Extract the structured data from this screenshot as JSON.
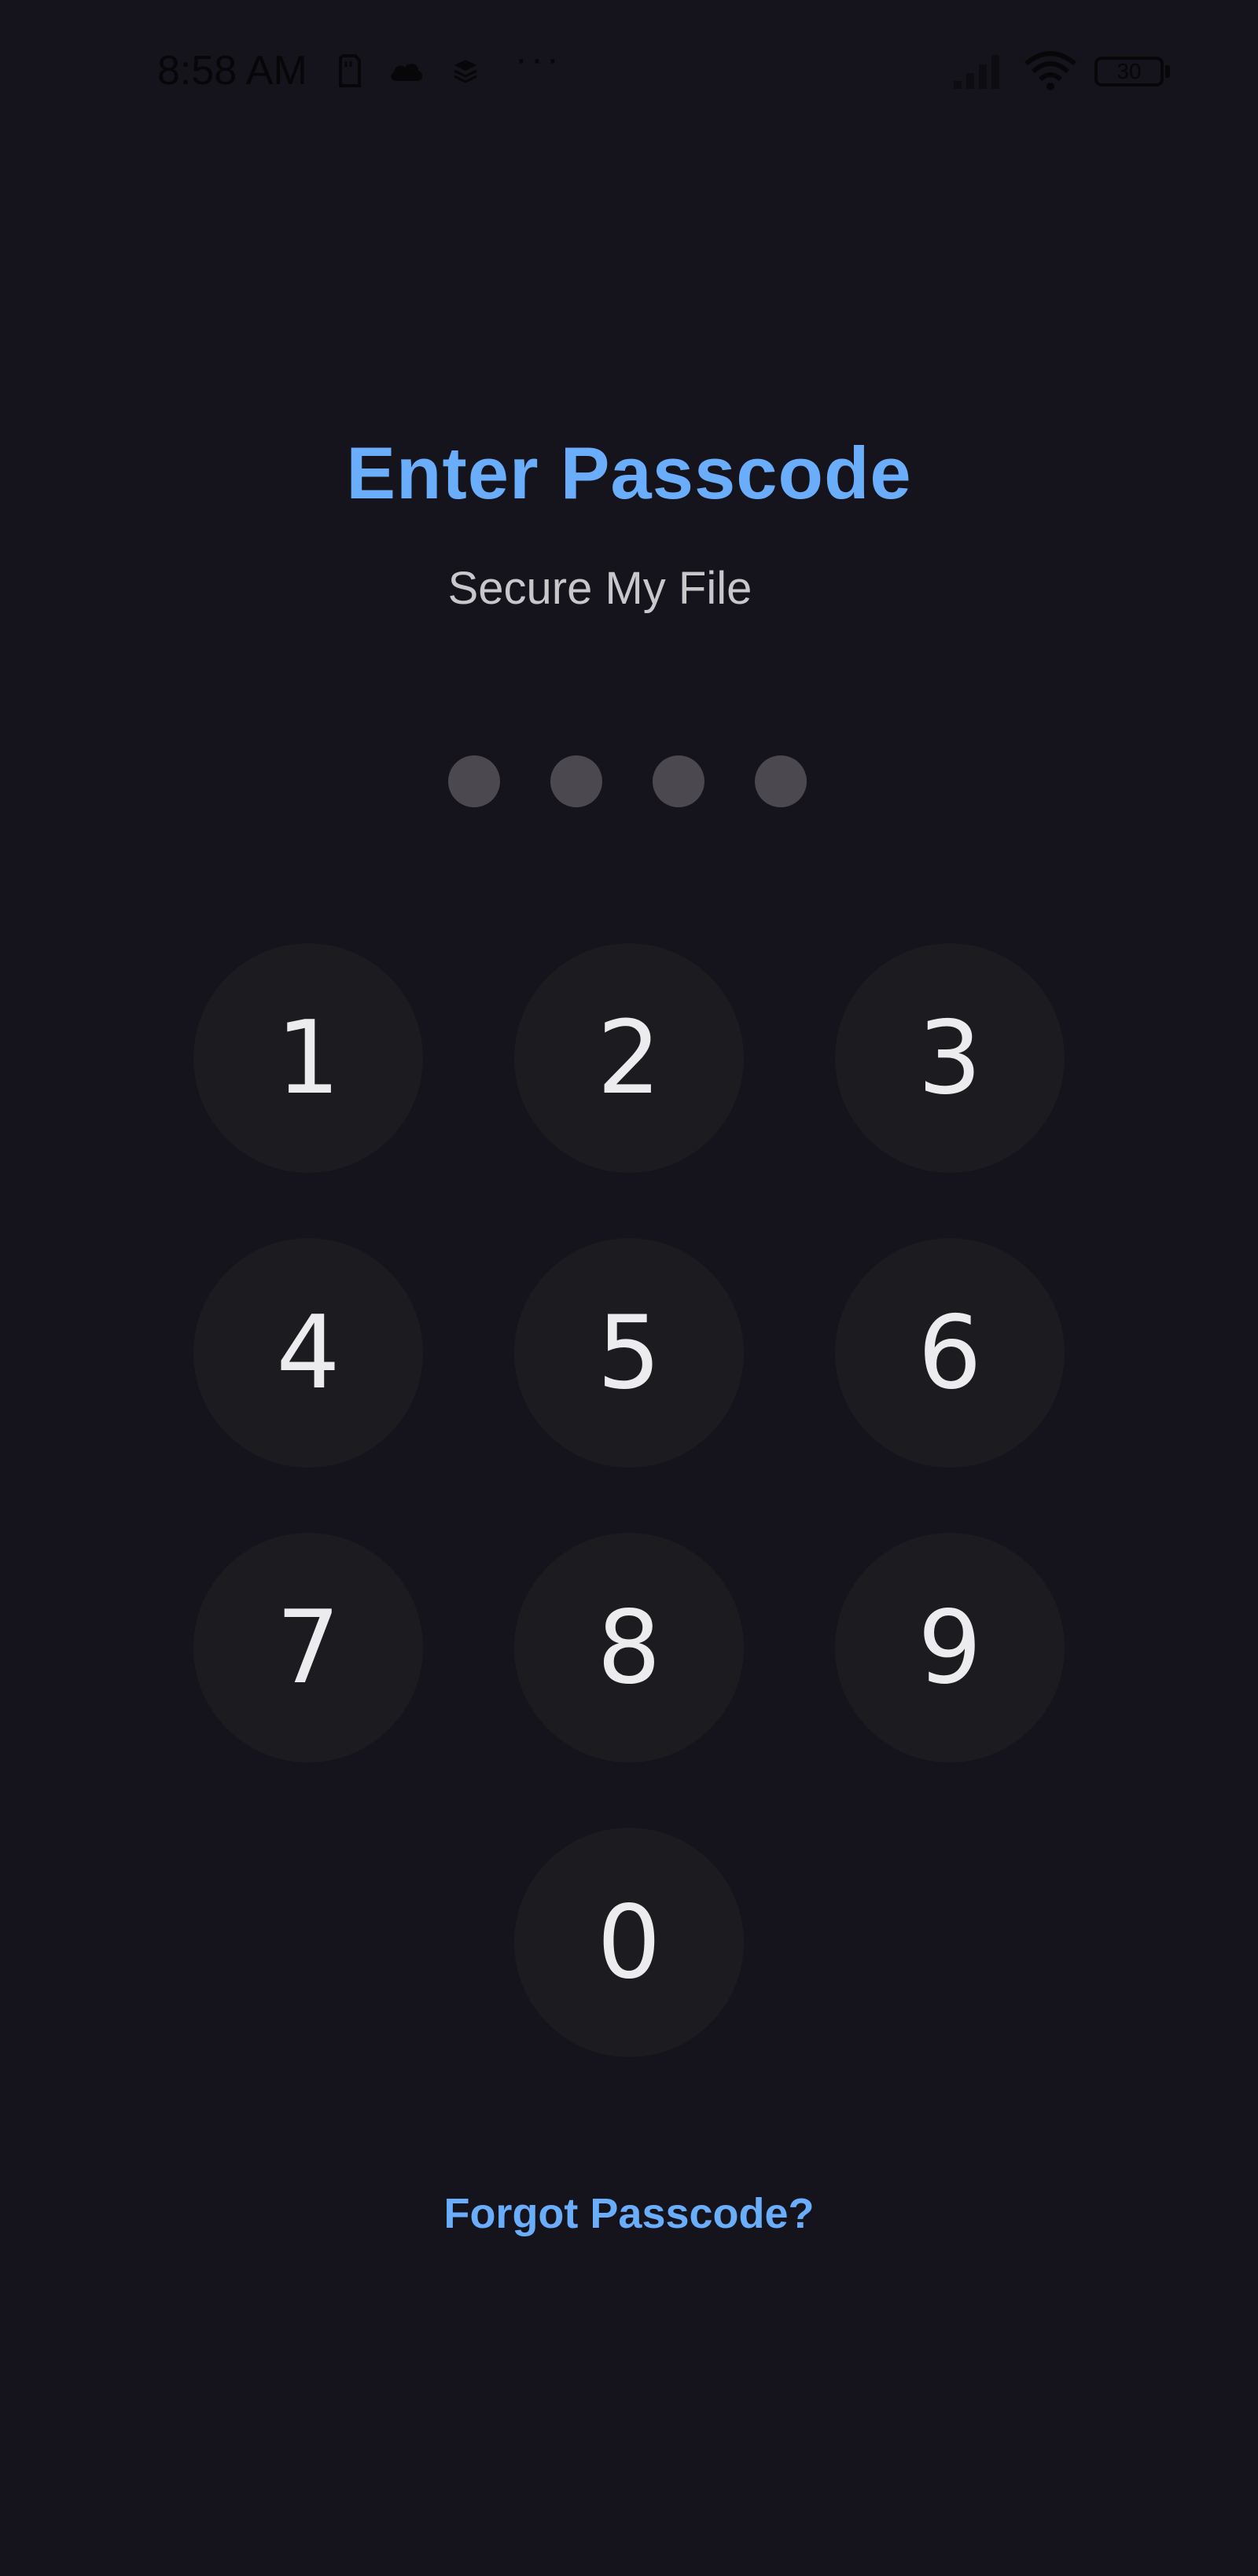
{
  "status_bar": {
    "time": "8:58 AM",
    "battery_level": "30",
    "icons": [
      "sd-card-icon",
      "cloud-icon",
      "layers-icon",
      "more-icon",
      "signal-icon",
      "wifi-icon",
      "battery-icon"
    ],
    "more_glyph": "···"
  },
  "screen": {
    "title": "Enter Passcode",
    "subtitle": "Secure My File",
    "entered_digits": 0,
    "passcode_length": 4,
    "forgot_label": "Forgot Passcode?"
  },
  "keypad": {
    "keys": [
      "1",
      "2",
      "3",
      "4",
      "5",
      "6",
      "7",
      "8",
      "9",
      "0"
    ]
  },
  "colors": {
    "background": "#15131b",
    "accent": "#6aaefb",
    "key_background": "#1c1b20",
    "key_text": "#ececef",
    "dot_empty": "#4b484f"
  }
}
